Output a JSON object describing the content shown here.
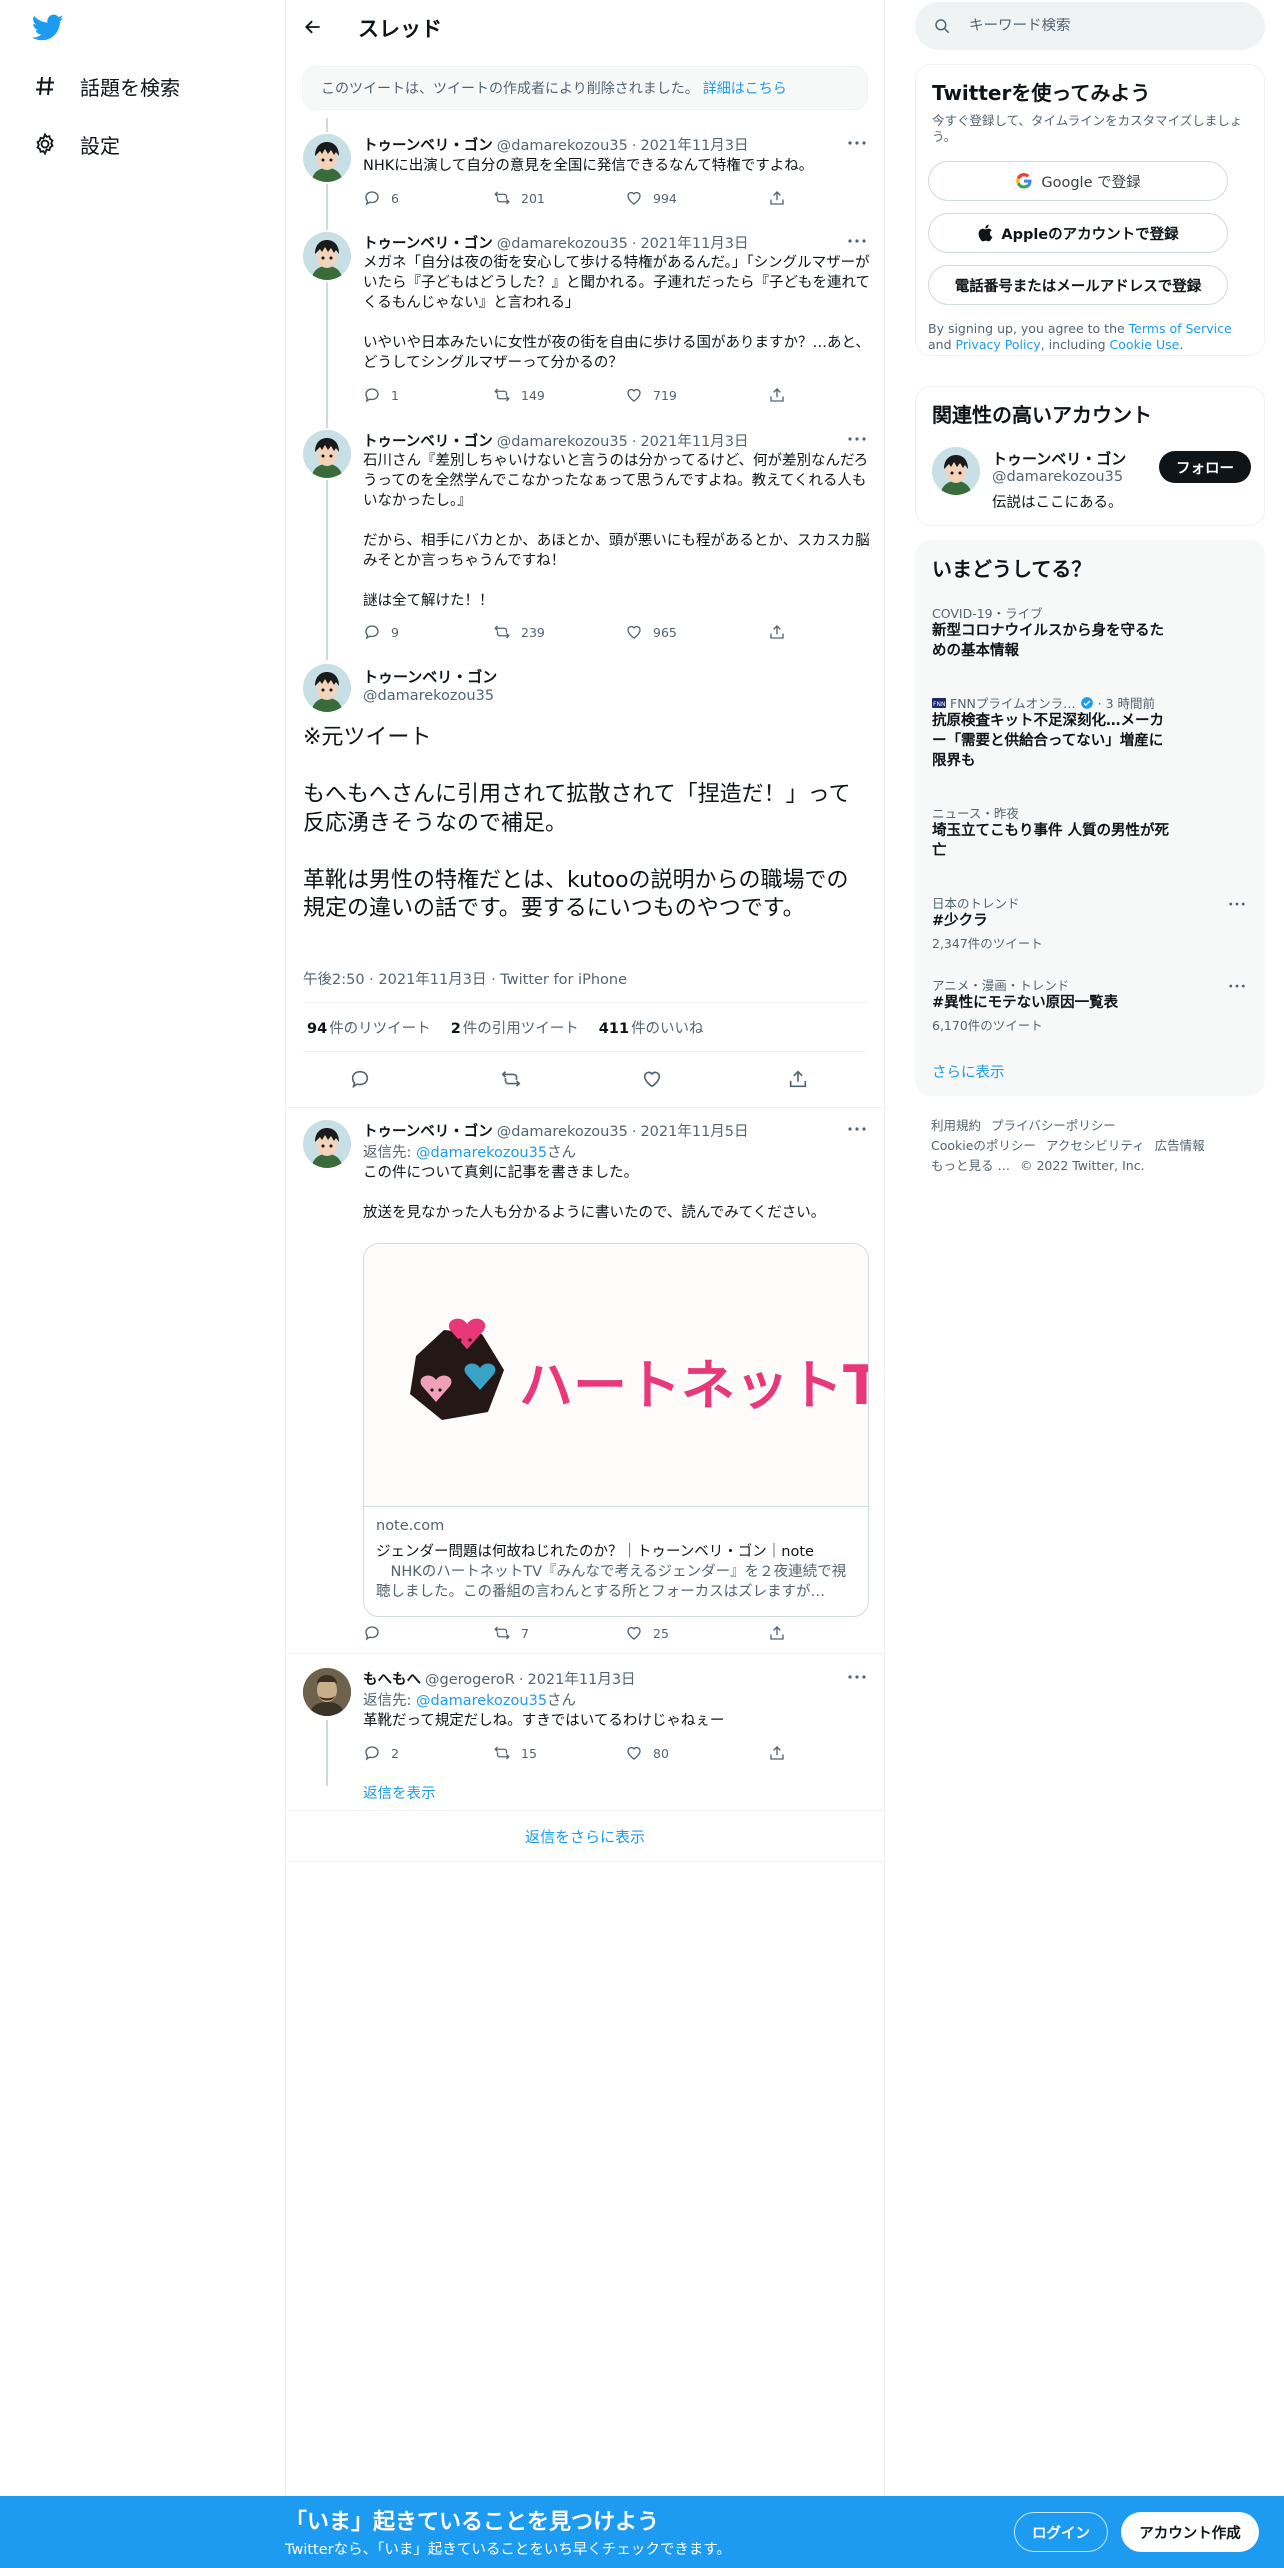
{
  "colors": {
    "accent": "#1d9bf0",
    "text": "#0f1419",
    "muted": "#536471",
    "border": "#eff3f4"
  },
  "nav": {
    "logo_icon": "twitter-bird-icon",
    "items": [
      {
        "label": "話題を検索",
        "icon": "hashtag-icon"
      },
      {
        "label": "設定",
        "icon": "gear-icon"
      }
    ]
  },
  "header": {
    "title": "スレッド",
    "back_icon": "back-arrow-icon"
  },
  "deleted_notice": {
    "text": "このツイートは、ツイートの作成者により削除されました。",
    "link": "詳細はこちら"
  },
  "thread": [
    {
      "name": "トゥーンベリ・ゴン",
      "handle": "@damarekozou35",
      "sep": "·",
      "date": "2021年11月3日",
      "text": "NHKに出演して自分の意見を全国に発信できるなんて特権ですよね。",
      "replies": "6",
      "retweets": "201",
      "likes": "994"
    },
    {
      "name": "トゥーンベリ・ゴン",
      "handle": "@damarekozou35",
      "sep": "·",
      "date": "2021年11月3日",
      "text": "メガネ「自分は夜の街を安心して歩ける特権があるんだ。」「シングルマザーがいたら『子どもはどうした？』と聞かれる。子連れだったら『子どもを連れてくるもんじゃない』と言われる」\n\nいやいや日本みたいに女性が夜の街を自由に歩ける国がありますか？…あと、どうしてシングルマザーって分かるの？",
      "replies": "1",
      "retweets": "149",
      "likes": "719"
    },
    {
      "name": "トゥーンベリ・ゴン",
      "handle": "@damarekozou35",
      "sep": "·",
      "date": "2021年11月3日",
      "text": "石川さん『差別しちゃいけないと言うのは分かってるけど、何が差別なんだろうってのを全然学んでこなかったなぁって思うんですよね。教えてくれる人もいなかったし。』\n\nだから、相手にバカとか、あほとか、頭が悪いにも程があるとか、スカスカ脳みそとか言っちゃうんですね！\n\n謎は全て解けた！！",
      "replies": "9",
      "retweets": "239",
      "likes": "965"
    }
  ],
  "focus": {
    "name": "トゥーンベリ・ゴン",
    "handle": "@damarekozou35",
    "text": "※元ツイート\n\nもへもへさんに引用されて拡散されて「捏造だ！」って反応湧きそうなので補足。\n\n革靴は男性の特権だとは、kutooの説明からの職場での規定の違いの話です。要するにいつものやつです。",
    "time": "午後2:50",
    "date": "2021年11月3日",
    "source": "Twitter for iPhone",
    "sep": "·",
    "retweets_count": "94",
    "retweets_label": "件のリツイート",
    "quotes_count": "2",
    "quotes_label": "件の引用ツイート",
    "likes_count": "411",
    "likes_label": "件のいいね"
  },
  "reply1": {
    "name": "トゥーンベリ・ゴン",
    "handle": "@damarekozou35",
    "sep": "·",
    "date": "2021年11月5日",
    "reply_prefix": "返信先: ",
    "reply_to": "@damarekozou35",
    "reply_suffix": "さん",
    "text": "この件について真剣に記事を書きました。\n\n放送を見なかった人も分かるように書いたので、読んでみてください。",
    "card": {
      "image_text": "ハートネットTV",
      "domain": "note.com",
      "title": "ジェンダー問題は何故ねじれたのか？｜トゥーンベリ・ゴン｜note",
      "description": "　NHKのハートネットTV『みんなで考えるジェンダー』を２夜連続で視聴しました。この番組の言わんとする所とフォーカスはズレますが…"
    },
    "replies": "",
    "retweets": "7",
    "likes": "25"
  },
  "reply2": {
    "name": "もへもへ",
    "handle": "@gerogeroR",
    "sep": "·",
    "date": "2021年11月3日",
    "reply_prefix": "返信先: ",
    "reply_to": "@damarekozou35",
    "reply_suffix": "さん",
    "text": "革靴だって規定だしね。すきではいてるわけじゃねぇー",
    "replies": "2",
    "retweets": "15",
    "likes": "80",
    "show_replies": "返信を表示"
  },
  "show_more_replies": "返信をさらに表示",
  "search": {
    "placeholder": "キーワード検索"
  },
  "signup": {
    "title": "Twitterを使ってみよう",
    "subtitle": "今すぐ登録して、タイムラインをカスタマイズしましょう。",
    "google": "Google で登録",
    "apple": "Appleのアカウントで登録",
    "phone": "電話番号またはメールアドレスで登録",
    "legal_1": "By signing up, you agree to the ",
    "legal_terms": "Terms of Service",
    "legal_2": " and ",
    "legal_privacy": "Privacy Policy",
    "legal_3": ", including ",
    "legal_cookie": "Cookie Use",
    "legal_4": "."
  },
  "related": {
    "title": "関連性の高いアカウント",
    "name": "トゥーンベリ・ゴン",
    "handle": "@damarekozou35",
    "bio": "伝説はここにある。",
    "follow": "フォロー"
  },
  "trends": {
    "title": "いまどうしてる？",
    "items": [
      {
        "context": "COVID-19・ライブ",
        "title": "新型コロナウイルスから身を守るための基本情報",
        "count": ""
      },
      {
        "context": "FNNプライムオンラ…",
        "context_time": "· 3 時間前",
        "title": "抗原検査キット不足深刻化…メーカー「需要と供給合ってない」増産に限界も",
        "count": ""
      },
      {
        "context": "ニュース・昨夜",
        "title": "埼玉立てこもり事件 人質の男性が死亡",
        "count": ""
      },
      {
        "context": "日本のトレンド",
        "title": "#少クラ",
        "count": "2,347件のツイート"
      },
      {
        "context": "アニメ・漫画・トレンド",
        "title": "#異性にモテない原因一覧表",
        "count": "6,170件のツイート"
      }
    ],
    "show_more": "さらに表示"
  },
  "footer": {
    "links": [
      "利用規約",
      "プライバシーポリシー",
      "Cookieのポリシー",
      "アクセシビリティ",
      "広告情報",
      "もっと見る …",
      "© 2022 Twitter, Inc."
    ]
  },
  "bottom_bar": {
    "title": "「いま」起きていることを見つけよう",
    "subtitle": "Twitterなら、「いま」起きていることをいち早くチェックできます。",
    "login": "ログイン",
    "signup": "アカウント作成"
  }
}
